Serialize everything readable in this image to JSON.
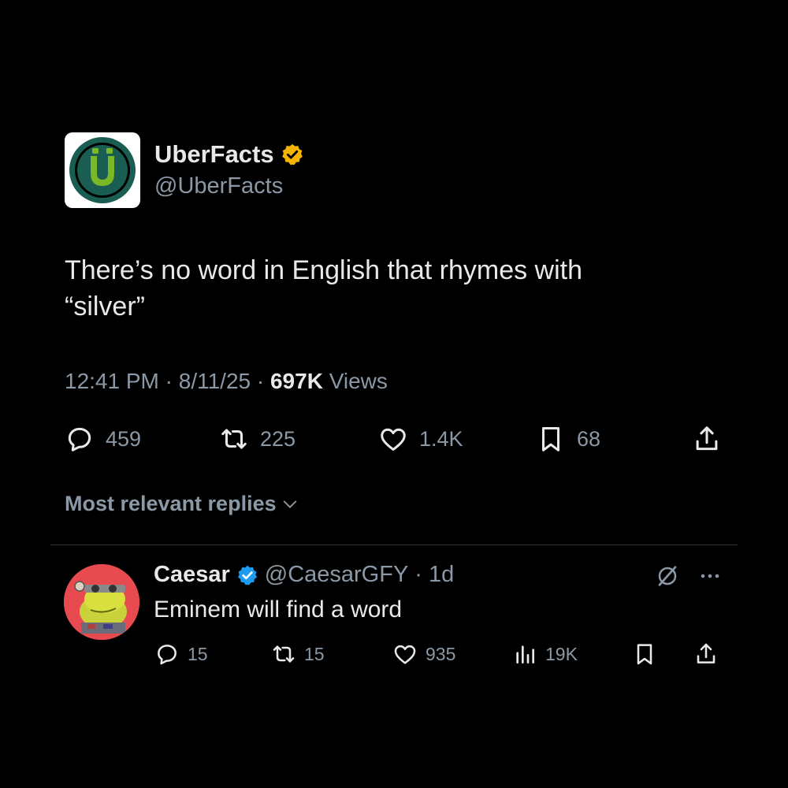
{
  "tweet": {
    "author_name": "UberFacts",
    "author_handle": "@UberFacts",
    "text_line1": "There’s no word in English that rhymes with",
    "text_line2": "“silver”",
    "time": "12:41 PM",
    "date": "8/11/25",
    "views_count": "697K",
    "views_label": "Views",
    "separator": "·",
    "replies": "459",
    "reposts": "225",
    "likes": "1.4K",
    "bookmarks": "68"
  },
  "replies_filter": {
    "label": "Most relevant replies"
  },
  "reply": {
    "author_name": "Caesar",
    "author_handle": "@CaesarGFY",
    "separator": "·",
    "age": "1d",
    "text": "Eminem will find a word",
    "replies": "15",
    "reposts": "15",
    "likes": "935",
    "views": "19K"
  },
  "icons": {
    "verified_gold": "verified-gold-icon",
    "verified_blue": "verified-blue-icon",
    "reply": "reply-icon",
    "repost": "repost-icon",
    "like": "like-icon",
    "bookmark": "bookmark-icon",
    "share": "share-icon",
    "views": "views-icon",
    "grok": "grok-icon",
    "more": "more-icon",
    "chevron": "chevron-down-icon"
  },
  "colors": {
    "background": "#000000",
    "text": "#e7e9ea",
    "muted": "#8b98a5",
    "gold_badge": "#f4b400",
    "blue_badge": "#1d9bf0",
    "logo_green": "#7ab828",
    "logo_ring": "#1a5d52",
    "avatar_red": "#e84b4f"
  }
}
